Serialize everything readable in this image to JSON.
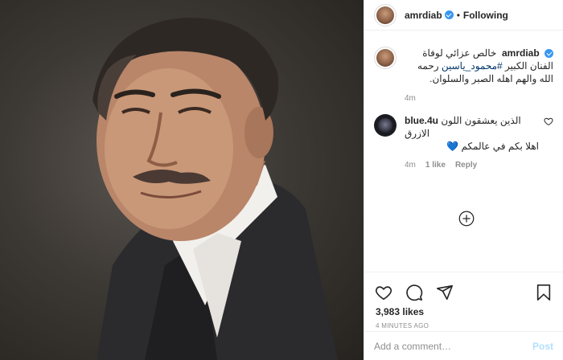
{
  "header": {
    "username": "amrdiab",
    "separator": "•",
    "follow_label": "Following"
  },
  "caption": {
    "username": "amrdiab",
    "text_before": "خالص عزائي لوفاة الفنان الكبير ",
    "hashtag": "#محمود_ياسين",
    "text_after": " رحمه الله والهم اهله الصبر والسلوان.",
    "time": "4m"
  },
  "comment": {
    "username": "blue.4u",
    "text_line1": "الذين يعشقون اللون الازرق",
    "text_line2": "اهلا بكم في عالمكم 💙",
    "time": "4m",
    "likes": "1 like",
    "reply_label": "Reply"
  },
  "stats": {
    "likes": "3,983 likes",
    "time_ago": "4 MINUTES AGO"
  },
  "comment_box": {
    "placeholder": "Add a comment…",
    "post_label": "Post"
  },
  "colors": {
    "verified": "#3897f0",
    "hashtag": "#00376b",
    "post_disabled": "#b2dffc",
    "muted": "#8e8e8e"
  }
}
